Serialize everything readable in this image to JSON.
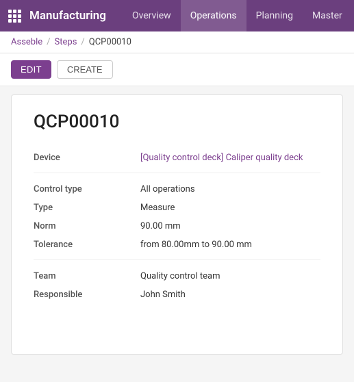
{
  "nav": {
    "brand": "Manufacturing",
    "links": [
      {
        "label": "Overview",
        "active": false
      },
      {
        "label": "Operations",
        "active": true
      },
      {
        "label": "Planning",
        "active": false
      },
      {
        "label": "Master",
        "active": false
      }
    ]
  },
  "breadcrumb": {
    "parent": "Asseble",
    "separator1": "/",
    "middle": "Steps",
    "separator2": "/",
    "current": "QCP00010"
  },
  "actions": {
    "edit_label": "EDIT",
    "create_label": "CREATE"
  },
  "record": {
    "title": "QCP00010",
    "fields": {
      "device_label": "Device",
      "device_value": "[Quality control deck] Caliper quality deck",
      "control_type_label": "Control type",
      "control_type_value": "All operations",
      "type_label": "Type",
      "type_value": "Measure",
      "norm_label": "Norm",
      "norm_value": "90.00 mm",
      "tolerance_label": "Tolerance",
      "tolerance_value": "from 80.00mm to 90.00 mm",
      "team_label": "Team",
      "team_value": "Quality control team",
      "responsible_label": "Responsible",
      "responsible_value": "John Smith"
    }
  }
}
